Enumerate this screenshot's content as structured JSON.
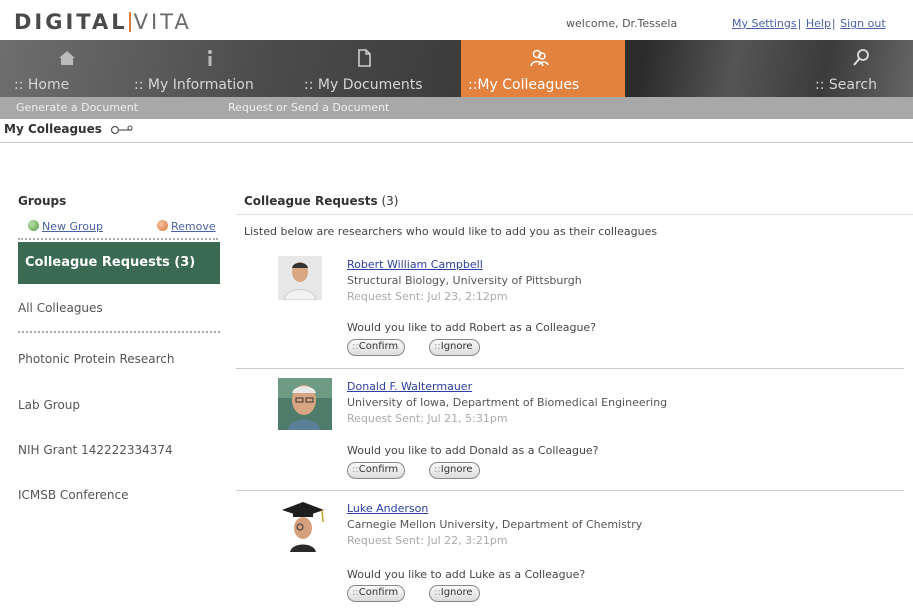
{
  "brand": {
    "part1": "DIGITAL",
    "part2": "VITA"
  },
  "header": {
    "welcome": "welcome, Dr.Tessela",
    "links": [
      "My Settings",
      "Help",
      "Sign out"
    ]
  },
  "nav": {
    "home": ":: Home",
    "info": ":: My Information",
    "docs": ":: My Documents",
    "colleagues": "::My Colleagues",
    "search": ":: Search"
  },
  "subnav": {
    "generate": "Generate a Document",
    "request": "Request or Send a Document"
  },
  "breadcrumb": "My Colleagues",
  "sidebar": {
    "title": "Groups",
    "new_group": "New Group",
    "remove": "Remove",
    "items": [
      "Colleague Requests (3)",
      "All Colleagues",
      "Photonic Protein Research",
      "Lab Group",
      "NIH Grant 142222334374",
      "ICMSB Conference"
    ]
  },
  "main": {
    "title": "Colleague Requests",
    "count": "(3)",
    "intro": "Listed below are researchers who would like to add you as their colleagues",
    "confirm_prefix": "::",
    "confirm": "Confirm",
    "ignore_prefix": "::",
    "ignore": "Ignore",
    "requests": [
      {
        "name": "Robert William Campbell",
        "affiliation": "Structural Biology, University of Pittsburgh",
        "sent": "Request Sent: Jul 23, 2:12pm",
        "question": "Would you like to add Robert as a Colleague?"
      },
      {
        "name": "Donald F. Waltermauer",
        "affiliation": "University of Iowa, Department of Biomedical Engineering",
        "sent": "Request Sent: Jul 21, 5:31pm",
        "question": "Would you like to add Donald as a Colleague?"
      },
      {
        "name": "Luke Anderson",
        "affiliation": "Carnegie Mellon University, Department of Chemistry",
        "sent": "Request Sent: Jul 22, 3:21pm",
        "question": "Would you like to add Luke as a Colleague?"
      }
    ]
  },
  "colors": {
    "accent": "#e2823e",
    "active_group": "#3a6b52",
    "link": "#2a3fa0"
  },
  "icons": {
    "home": "home-icon",
    "info": "info-icon",
    "docs": "document-icon",
    "colleagues": "colleagues-icon",
    "search": "search-icon",
    "key": "key-icon"
  }
}
